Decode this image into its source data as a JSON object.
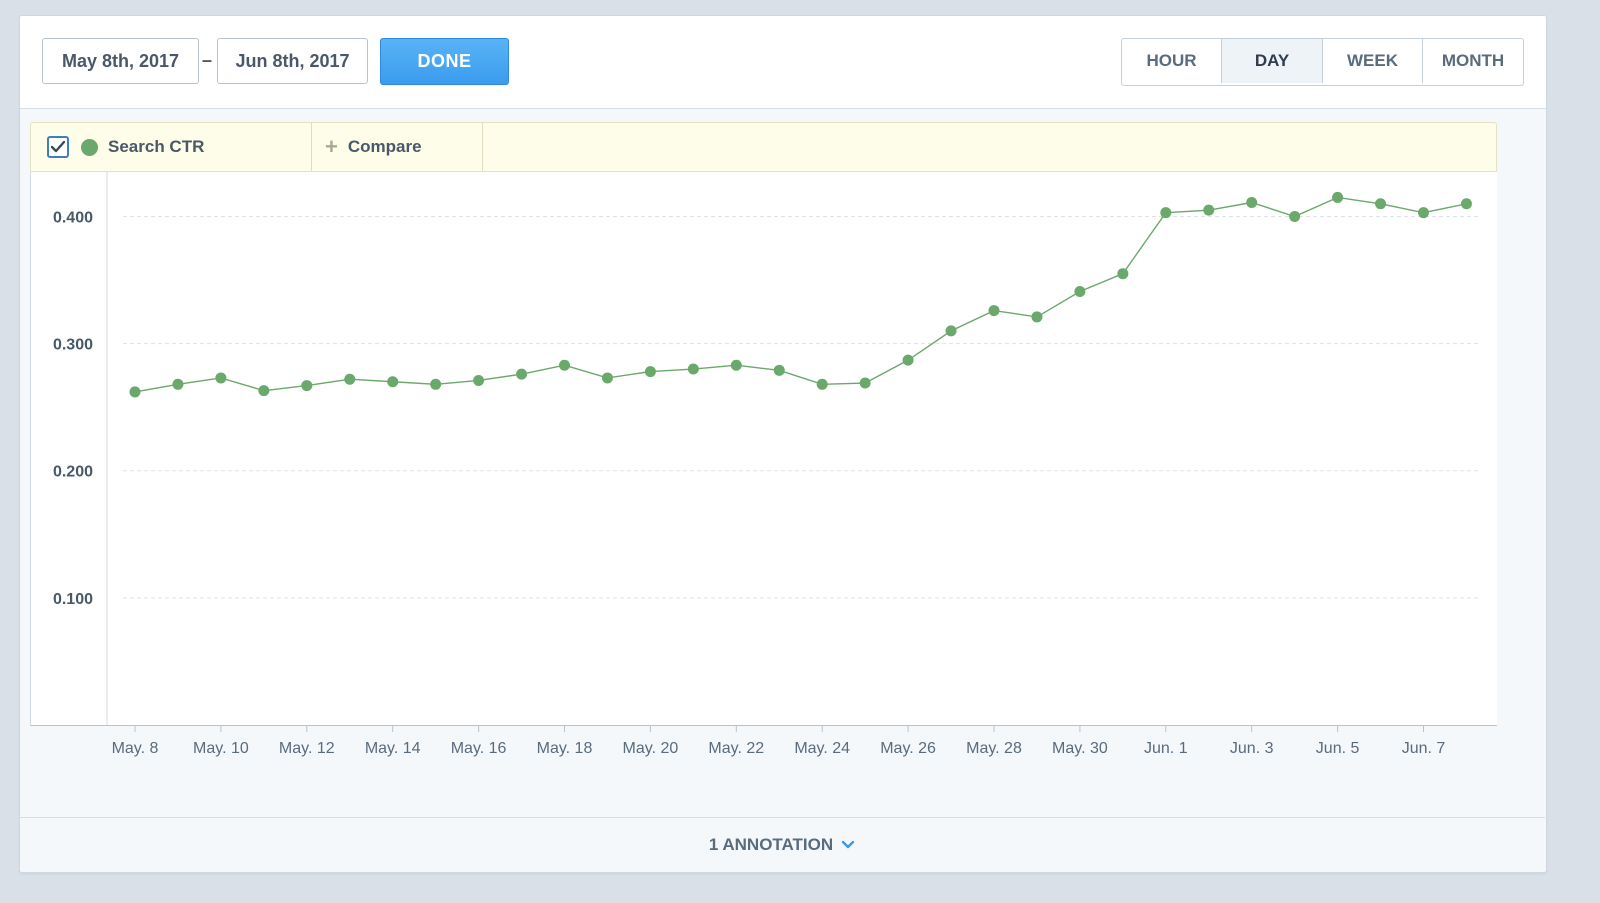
{
  "toolbar": {
    "start_date": "May 8th, 2017",
    "dash": "–",
    "end_date": "Jun 8th, 2017",
    "done_label": "DONE",
    "granularity": [
      "HOUR",
      "DAY",
      "WEEK",
      "MONTH"
    ],
    "active_granularity": "DAY"
  },
  "legend": {
    "series_checked": true,
    "series_name": "Search CTR",
    "series_color": "#6ba86b",
    "compare_label": "Compare"
  },
  "footer": {
    "annotation_label": "1 ANNOTATION",
    "chevron_icon": "chevron-down-icon"
  },
  "chart_data": {
    "type": "line",
    "x": [
      "May 8",
      "May 9",
      "May 10",
      "May 11",
      "May 12",
      "May 13",
      "May 14",
      "May 15",
      "May 16",
      "May 17",
      "May 18",
      "May 19",
      "May 20",
      "May 21",
      "May 22",
      "May 23",
      "May 24",
      "May 25",
      "May 26",
      "May 27",
      "May 28",
      "May 29",
      "May 30",
      "May 31",
      "Jun 1",
      "Jun 2",
      "Jun 3",
      "Jun 4",
      "Jun 5",
      "Jun 6",
      "Jun 7",
      "Jun 8"
    ],
    "series": [
      {
        "name": "Search CTR",
        "color": "#6ba86b",
        "values": [
          0.262,
          0.268,
          0.273,
          0.263,
          0.267,
          0.272,
          0.27,
          0.268,
          0.271,
          0.276,
          0.283,
          0.273,
          0.278,
          0.28,
          0.283,
          0.279,
          0.268,
          0.269,
          0.287,
          0.31,
          0.326,
          0.321,
          0.341,
          0.355,
          0.403,
          0.405,
          0.411,
          0.4,
          0.415,
          0.41,
          0.403,
          0.41
        ]
      }
    ],
    "x_tick_labels": [
      "May. 8",
      "May. 10",
      "May. 12",
      "May. 14",
      "May. 16",
      "May. 18",
      "May. 20",
      "May. 22",
      "May. 24",
      "May. 26",
      "May. 28",
      "May. 30",
      "Jun. 1",
      "Jun. 3",
      "Jun. 5",
      "Jun. 7"
    ],
    "y_ticks": [
      "0.100",
      "0.200",
      "0.300",
      "0.400"
    ],
    "ylim": [
      0,
      0.435
    ],
    "grid": true,
    "title": "",
    "xlabel": "",
    "ylabel": ""
  }
}
